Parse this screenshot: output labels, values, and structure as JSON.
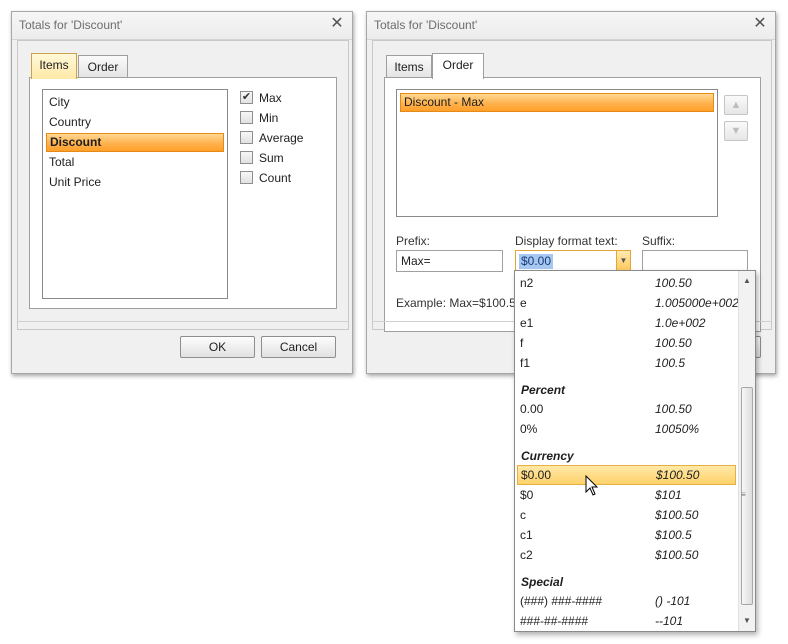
{
  "left_dialog": {
    "title": "Totals for 'Discount'",
    "close": "✕",
    "tabs": [
      "Items",
      "Order"
    ],
    "fields": [
      "City",
      "Country",
      "Discount",
      "Total",
      "Unit Price"
    ],
    "selected_field": "Discount",
    "totals": [
      {
        "label": "Max",
        "checked": true
      },
      {
        "label": "Min",
        "checked": false
      },
      {
        "label": "Average",
        "checked": false
      },
      {
        "label": "Sum",
        "checked": false
      },
      {
        "label": "Count",
        "checked": false
      }
    ],
    "ok_label": "OK",
    "cancel_label": "Cancel"
  },
  "right_dialog": {
    "title": "Totals for 'Discount'",
    "close": "✕",
    "tabs": [
      "Items",
      "Order"
    ],
    "order_items": [
      "Discount - Max"
    ],
    "up_icon": "▲",
    "down_icon": "▼",
    "prefix_label": "Prefix:",
    "prefix_value": "Max=",
    "format_label": "Display format text:",
    "format_value": "$0.00",
    "suffix_label": "Suffix:",
    "suffix_value": "",
    "example_text": "Example: Max=$100.50"
  },
  "dropdown": {
    "rows": [
      {
        "kind": "item",
        "fmt": "n2",
        "ex": "100.50"
      },
      {
        "kind": "item",
        "fmt": "e",
        "ex": "1.005000e+002"
      },
      {
        "kind": "item",
        "fmt": "e1",
        "ex": "1.0e+002"
      },
      {
        "kind": "item",
        "fmt": "f",
        "ex": "100.50"
      },
      {
        "kind": "item",
        "fmt": "f1",
        "ex": "100.5"
      },
      {
        "kind": "header",
        "fmt": "Percent"
      },
      {
        "kind": "item",
        "fmt": "0.00",
        "ex": "100.50"
      },
      {
        "kind": "item",
        "fmt": "0%",
        "ex": "10050%"
      },
      {
        "kind": "header",
        "fmt": "Currency"
      },
      {
        "kind": "item",
        "fmt": "$0.00",
        "ex": "$100.50",
        "selected": true
      },
      {
        "kind": "item",
        "fmt": "$0",
        "ex": "$101"
      },
      {
        "kind": "item",
        "fmt": "c",
        "ex": "$100.50"
      },
      {
        "kind": "item",
        "fmt": "c1",
        "ex": "$100.5"
      },
      {
        "kind": "item",
        "fmt": "c2",
        "ex": "$100.50"
      },
      {
        "kind": "header",
        "fmt": "Special"
      },
      {
        "kind": "item",
        "fmt": "(###) ###-####",
        "ex": "() -101"
      },
      {
        "kind": "item",
        "fmt": "###-##-####",
        "ex": "--101"
      }
    ]
  },
  "colors": {
    "selection_orange": "#ffb24e",
    "dropdown_highlight": "#ffd16a",
    "text_selection": "#a6c8f0"
  }
}
